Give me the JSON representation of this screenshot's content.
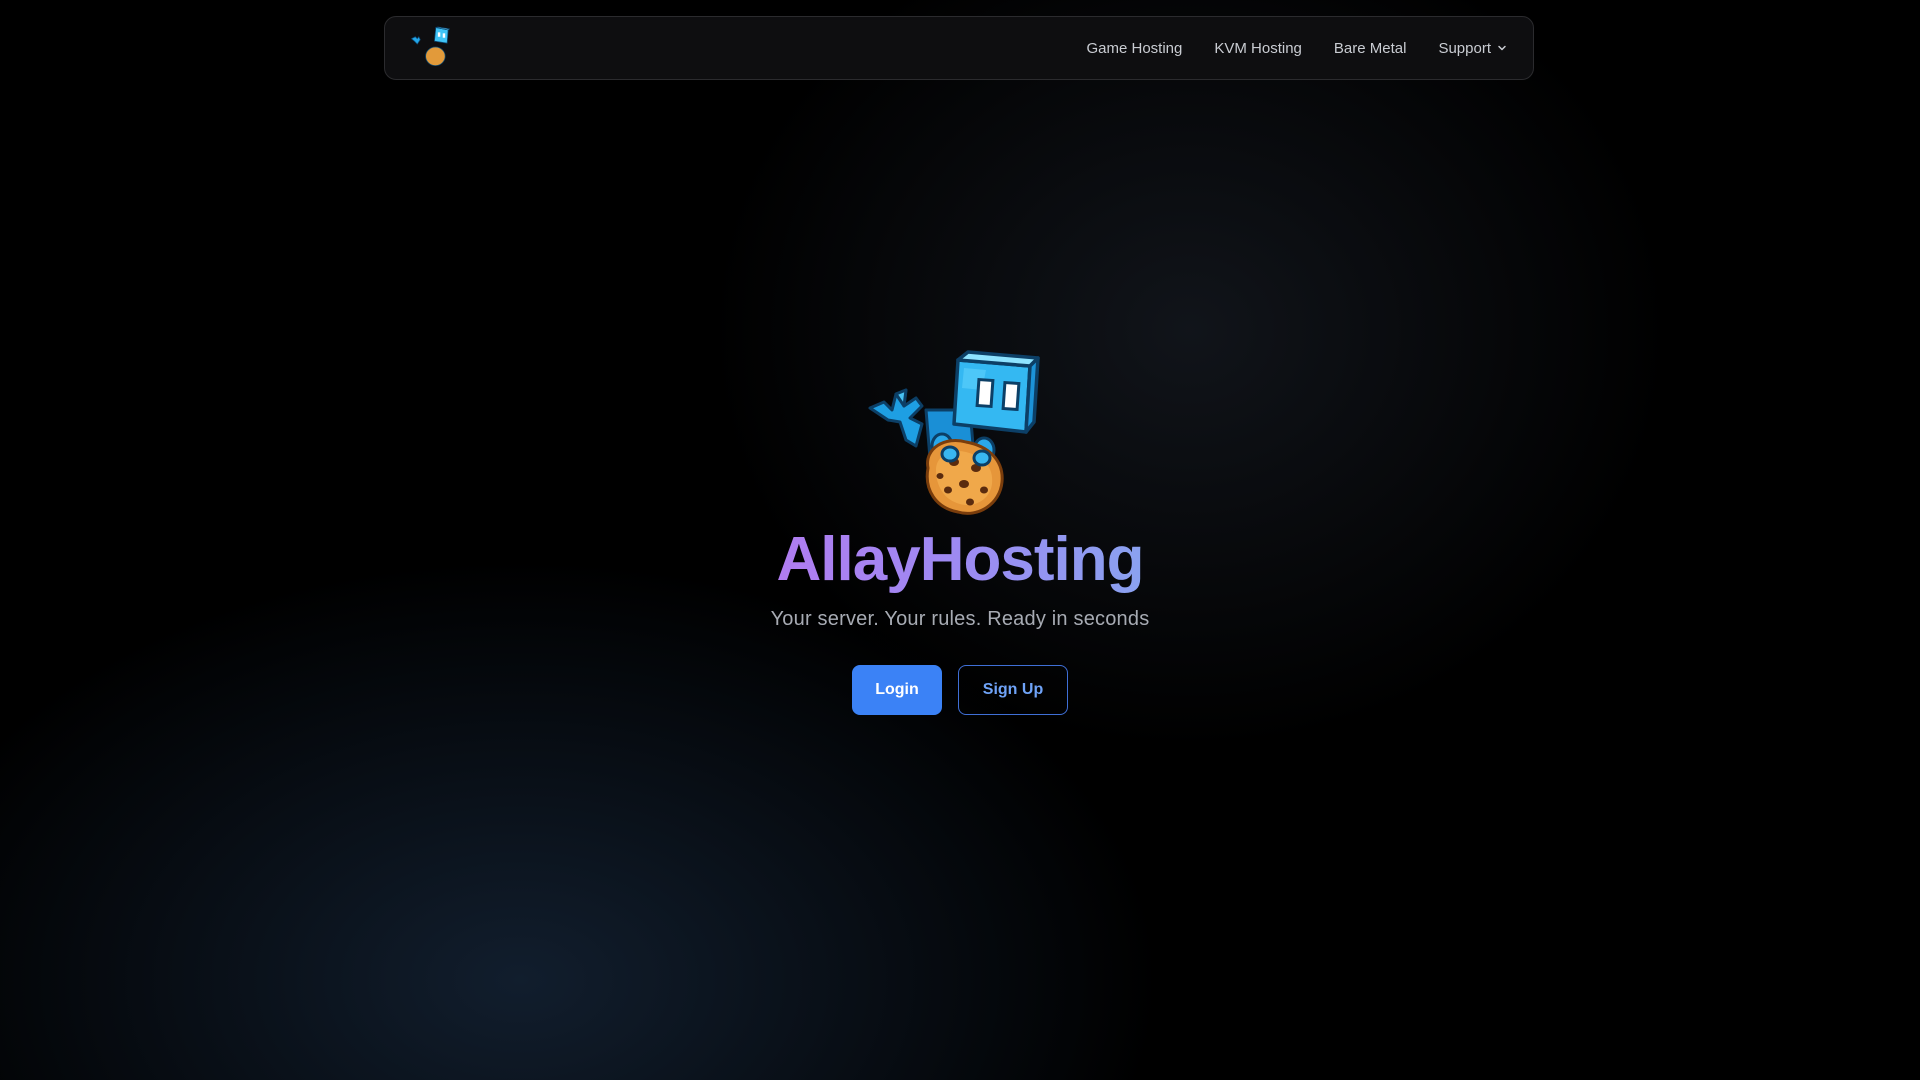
{
  "nav": {
    "logo_icon": "allay-mascot-icon",
    "links": [
      {
        "label": "Game Hosting"
      },
      {
        "label": "KVM Hosting"
      },
      {
        "label": "Bare Metal"
      },
      {
        "label": "Support",
        "has_dropdown": true
      }
    ]
  },
  "hero": {
    "mascot_icon": "allay-mascot-icon",
    "title": "AllayHosting",
    "tagline": "Your server. Your rules. Ready in seconds",
    "login_label": "Login",
    "signup_label": "Sign Up"
  },
  "colors": {
    "primary": "#3b82f6",
    "title_gradient_start": "#b07cf0",
    "title_gradient_end": "#8aa2f0",
    "background": "#000000"
  }
}
